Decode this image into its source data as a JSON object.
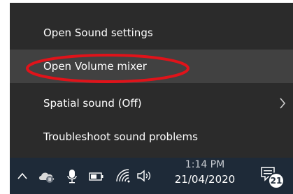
{
  "menu": {
    "items": [
      {
        "label": "Open Sound settings"
      },
      {
        "label": "Open Volume mixer"
      },
      {
        "label": "Spatial sound (Off)"
      },
      {
        "label": "Troubleshoot sound problems"
      }
    ]
  },
  "taskbar": {
    "tray_icons": [
      "chevron-up-icon",
      "onedrive-icon",
      "microphone-icon",
      "battery-icon",
      "wifi-icon",
      "speaker-icon"
    ],
    "clock": {
      "time": "1:14 PM",
      "date": "21/04/2020"
    },
    "notifications": {
      "count": "21"
    }
  },
  "colors": {
    "menu_bg": "#2b2b2b",
    "menu_hover": "#414141",
    "taskbar_bg": "#1e2a38",
    "annotation": "#e0131a"
  }
}
